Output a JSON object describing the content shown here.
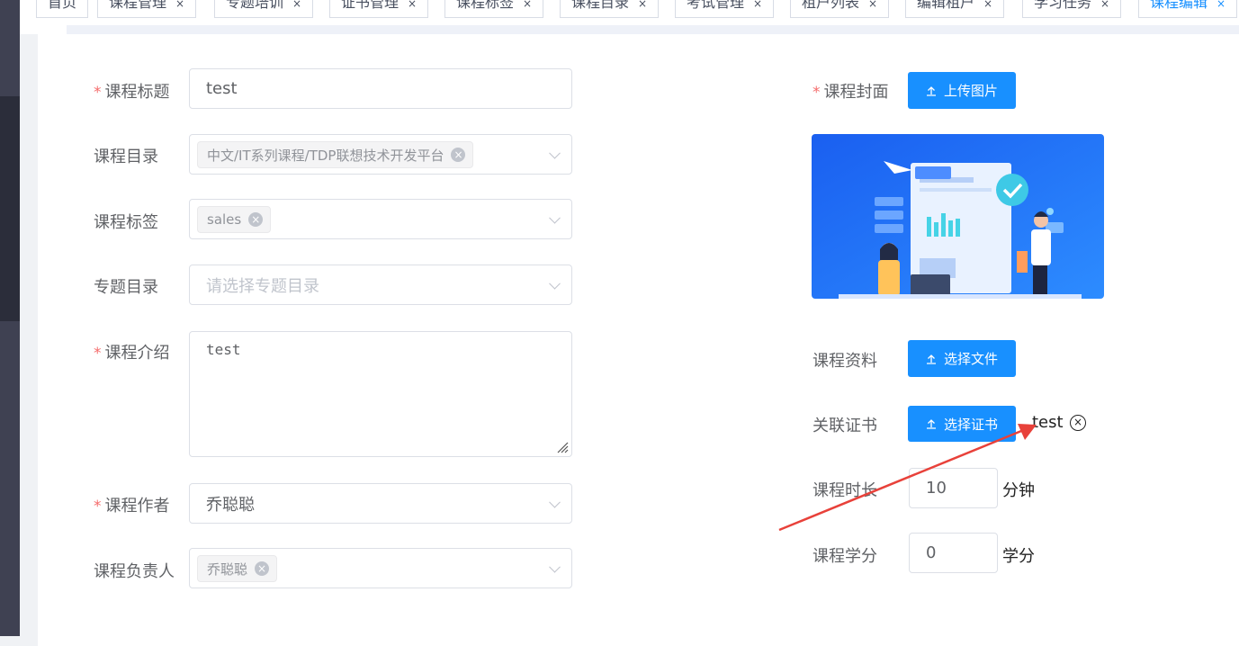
{
  "tabs": [
    {
      "label": "首页",
      "closable": false,
      "active": false
    },
    {
      "label": "课程管理",
      "closable": true,
      "active": false
    },
    {
      "label": "专题培训",
      "closable": true,
      "active": false
    },
    {
      "label": "证书管理",
      "closable": true,
      "active": false
    },
    {
      "label": "课程标签",
      "closable": true,
      "active": false
    },
    {
      "label": "课程目录",
      "closable": true,
      "active": false
    },
    {
      "label": "考试管理",
      "closable": true,
      "active": false
    },
    {
      "label": "租户列表",
      "closable": true,
      "active": false
    },
    {
      "label": "编辑租户",
      "closable": true,
      "active": false
    },
    {
      "label": "学习任务",
      "closable": true,
      "active": false
    },
    {
      "label": "课程编辑",
      "closable": true,
      "active": true
    }
  ],
  "form": {
    "title": {
      "label": "课程标题",
      "required": true,
      "value": "test"
    },
    "catalog": {
      "label": "课程目录",
      "required": false,
      "tags": [
        "中文/IT系列课程/TDP联想技术开发平台"
      ]
    },
    "course_tags": {
      "label": "课程标签",
      "required": false,
      "tags": [
        "sales"
      ]
    },
    "topic": {
      "label": "专题目录",
      "required": false,
      "placeholder": "请选择专题目录"
    },
    "intro": {
      "label": "课程介绍",
      "required": true,
      "value": "test"
    },
    "author": {
      "label": "课程作者",
      "required": true,
      "value": "乔聪聪"
    },
    "owner": {
      "label": "课程负责人",
      "required": false,
      "tags": [
        "乔聪聪"
      ]
    },
    "cover": {
      "label": "课程封面",
      "required": true,
      "button": "上传图片"
    },
    "material": {
      "label": "课程资料",
      "button": "选择文件"
    },
    "certificate": {
      "label": "关联证书",
      "button": "选择证书",
      "selected": "test"
    },
    "duration": {
      "label": "课程时长",
      "value": "10",
      "unit": "分钟"
    },
    "credit": {
      "label": "课程学分",
      "value": "0",
      "unit": "学分"
    }
  },
  "colors": {
    "primary": "#1890ff",
    "required": "#f56c6c",
    "annotation": "#e8413a"
  },
  "icons": {
    "upload": "upload-icon",
    "tag_close": "close-icon",
    "select": "chevron-down-icon"
  }
}
